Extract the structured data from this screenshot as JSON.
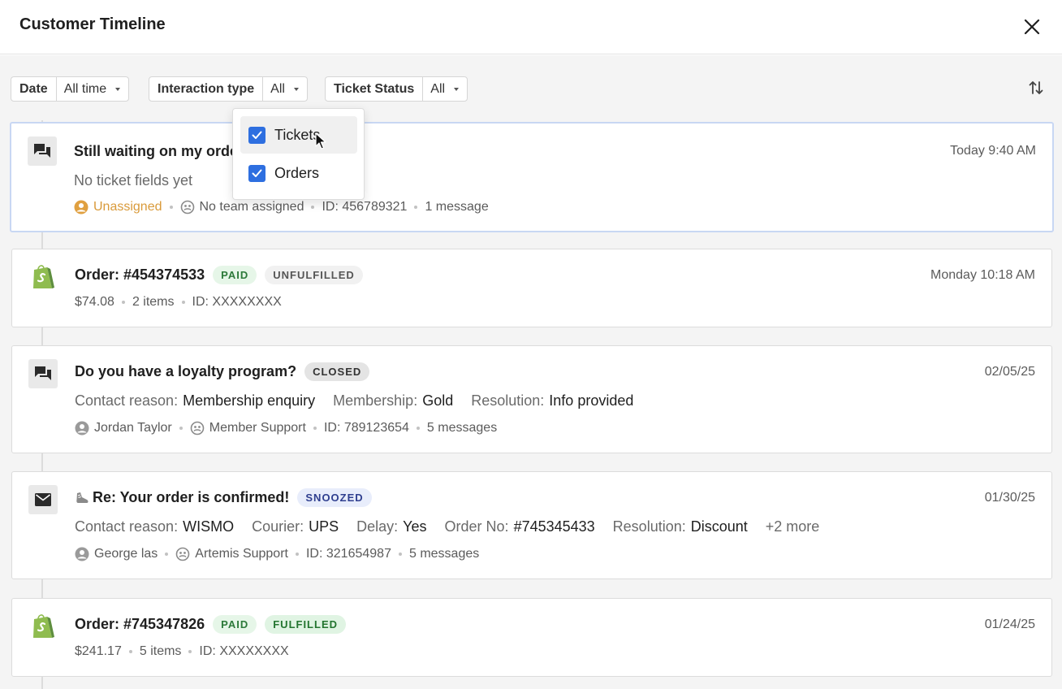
{
  "header": {
    "title": "Customer Timeline"
  },
  "filters": {
    "date": {
      "label": "Date",
      "value": "All time"
    },
    "interaction_type": {
      "label": "Interaction type",
      "value": "All"
    },
    "ticket_status": {
      "label": "Ticket Status",
      "value": "All"
    }
  },
  "dropdown": {
    "options": [
      {
        "label": "Tickets",
        "checked": true
      },
      {
        "label": "Orders",
        "checked": true
      }
    ]
  },
  "cards": [
    {
      "title": "Still waiting on my orde",
      "time": "Today 9:40 AM",
      "no_fields": "No ticket fields yet",
      "assignee": "Unassigned",
      "team": "No team assigned",
      "id": "ID: 456789321",
      "messages": "1 message"
    },
    {
      "title": "Order: #454374533",
      "badges": [
        "PAID",
        "UNFULFILLED"
      ],
      "time": "Monday 10:18 AM",
      "amount": "$74.08",
      "items": "2 items",
      "id": "ID: XXXXXXXX"
    },
    {
      "title": "Do you have a loyalty program?",
      "badges": [
        "CLOSED"
      ],
      "time": "02/05/25",
      "fields": [
        {
          "k": "Contact reason:",
          "v": "Membership enquiry"
        },
        {
          "k": "Membership:",
          "v": "Gold"
        },
        {
          "k": "Resolution:",
          "v": "Info provided"
        }
      ],
      "assignee": "Jordan Taylor",
      "team": "Member Support",
      "id": "ID: 789123654",
      "messages": "5 messages"
    },
    {
      "title": "Re: Your order is confirmed!",
      "badges": [
        "SNOOZED"
      ],
      "time": "01/30/25",
      "fields": [
        {
          "k": "Contact reason:",
          "v": "WISMO"
        },
        {
          "k": "Courier:",
          "v": "UPS"
        },
        {
          "k": "Delay:",
          "v": "Yes"
        },
        {
          "k": "Order No:",
          "v": "#745345433"
        },
        {
          "k": "Resolution:",
          "v": "Discount"
        }
      ],
      "more": "+2 more",
      "assignee": "George las",
      "team": "Artemis Support",
      "id": "ID: 321654987",
      "messages": "5 messages"
    },
    {
      "title": "Order: #745347826",
      "badges": [
        "PAID",
        "FULFILLED"
      ],
      "time": "01/24/25",
      "amount": "$241.17",
      "items": "5 items",
      "id": "ID: XXXXXXXX"
    }
  ],
  "colors": {
    "accent": "#2e6fe0",
    "unassigned": "#d99a3a",
    "selected_border": "#c8d7f3"
  }
}
